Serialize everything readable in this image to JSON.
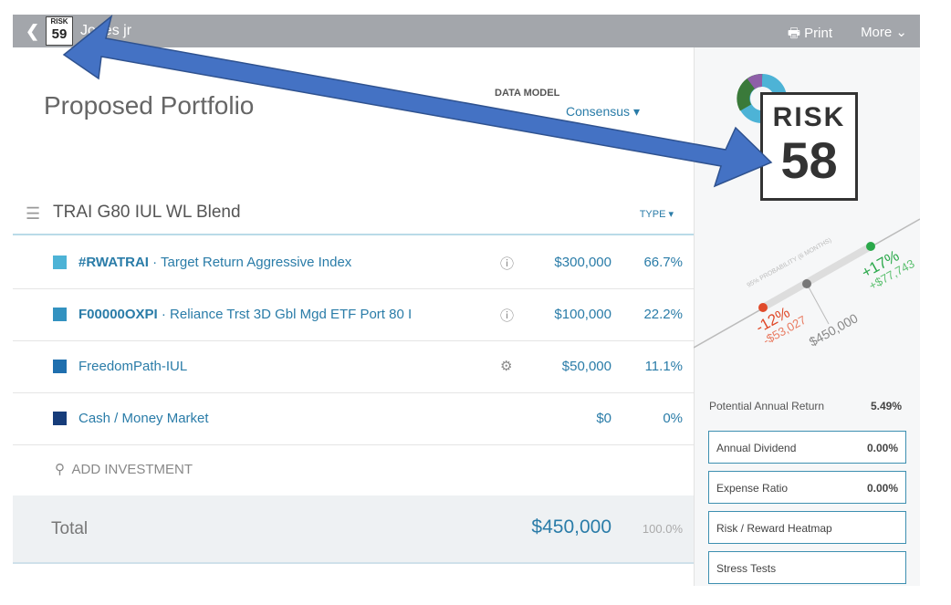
{
  "header": {
    "risk_label": "RISK",
    "risk_score": "59",
    "client_name": "Jones jr",
    "print_label": "Print",
    "more_label": "More"
  },
  "page": {
    "title": "Proposed Portfolio",
    "data_model_label": "DATA MODEL",
    "data_model_value": "Consensus"
  },
  "group": {
    "name": "TRAI G80 IUL WL Blend",
    "type_label": "TYPE"
  },
  "rows": [
    {
      "ticker": "#RWATRAI",
      "name": " · Target Return Aggressive Index",
      "icon": "info-icon",
      "amount": "$300,000",
      "pct": "66.7%",
      "color": "#4db3d6"
    },
    {
      "ticker": "F00000OXPI",
      "name": " · Reliance Trst 3D Gbl Mgd ETF Port 80 I",
      "icon": "info-icon",
      "amount": "$100,000",
      "pct": "22.2%",
      "color": "#3392c0"
    },
    {
      "ticker": "",
      "name": "FreedomPath-IUL",
      "icon": "gears-icon",
      "amount": "$50,000",
      "pct": "11.1%",
      "color": "#1f6fae"
    },
    {
      "ticker": "",
      "name": "Cash / Money Market",
      "icon": "",
      "amount": "$0",
      "pct": "0%",
      "color": "#163c7a"
    }
  ],
  "add_investment": "ADD INVESTMENT",
  "total": {
    "label": "Total",
    "value": "$450,000",
    "pct": "100.0%"
  },
  "sidebar": {
    "risk_label": "RISK",
    "risk_score": "58",
    "probability_label": "95% PROBABILITY (6 MONTHS)",
    "low_pct": "-12%",
    "low_amt": "-$53,027",
    "mid_amt": "$450,000",
    "high_pct": "+17%",
    "high_amt": "+$77,743",
    "par_label": "Potential Annual Return",
    "par_value": "5.49%",
    "buttons": [
      {
        "label": "Annual Dividend",
        "value": "0.00%"
      },
      {
        "label": "Expense Ratio",
        "value": "0.00%"
      },
      {
        "label": "Risk / Reward Heatmap",
        "value": ""
      },
      {
        "label": "Stress Tests",
        "value": ""
      }
    ]
  },
  "colors": {
    "accent": "#2a7ca8",
    "arrow": "#4472c4",
    "negative": "#e04a2a",
    "positive": "#2aa84a"
  }
}
